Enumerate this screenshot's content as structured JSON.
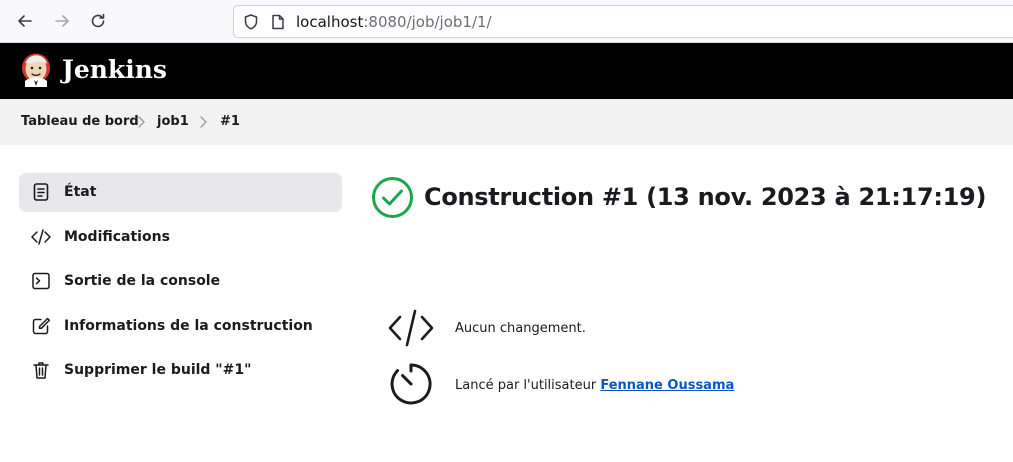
{
  "browser": {
    "url_host": "localhost",
    "url_rest": ":8080/job/job1/1/",
    "icons": {
      "back": "arrow-left-icon",
      "forward": "arrow-right-icon",
      "reload": "reload-icon",
      "security": "shield-icon",
      "page": "page-icon"
    }
  },
  "header": {
    "title": "Jenkins",
    "logo": "jenkins-butler-logo"
  },
  "breadcrumb": {
    "items": [
      {
        "label": "Tableau de bord"
      },
      {
        "label": "job1"
      },
      {
        "label": "#1"
      }
    ]
  },
  "sidebar": {
    "items": [
      {
        "label": "État",
        "icon": "document-icon",
        "active": true
      },
      {
        "label": "Modifications",
        "icon": "code-icon",
        "active": false
      },
      {
        "label": "Sortie de la console",
        "icon": "terminal-icon",
        "active": false
      },
      {
        "label": "Informations de la construction",
        "icon": "edit-icon",
        "active": false
      },
      {
        "label": "Supprimer le build \"#1\"",
        "icon": "trash-icon",
        "active": false
      }
    ]
  },
  "main": {
    "title": "Construction #1 (13 nov. 2023 à 21:17:19)",
    "status": "success",
    "status_icon": "success-check-icon",
    "changes_text": "Aucun changement.",
    "started_by_prefix": "Lancé par l'utilisateur ",
    "started_by_user": "Fennane Oussama"
  },
  "colors": {
    "success": "#1ea64b",
    "link": "#0a55c8",
    "header_bg": "#000000",
    "active_bg": "#e8e8ec"
  }
}
